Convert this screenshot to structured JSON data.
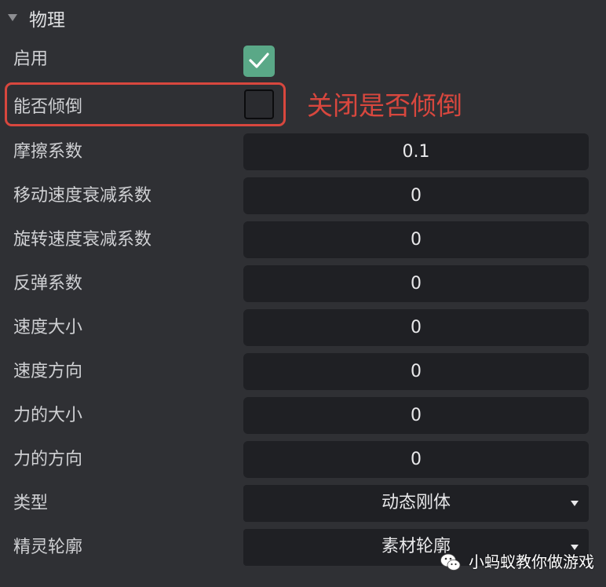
{
  "section": {
    "title": "物理",
    "collapse_icon": "triangle-down-icon"
  },
  "properties": {
    "enabled": {
      "label": "启用",
      "checked": true,
      "icon": "checkmark-icon",
      "color": "#5aa887"
    },
    "can_topple": {
      "label": "能否倾倒",
      "checked": false
    },
    "friction": {
      "label": "摩擦系数",
      "value": "0.1"
    },
    "linear_damping": {
      "label": "移动速度衰减系数",
      "value": "0"
    },
    "angular_damping": {
      "label": "旋转速度衰减系数",
      "value": "0"
    },
    "restitution": {
      "label": "反弹系数",
      "value": "0"
    },
    "speed_magnitude": {
      "label": "速度大小",
      "value": "0"
    },
    "speed_direction": {
      "label": "速度方向",
      "value": "0"
    },
    "force_magnitude": {
      "label": "力的大小",
      "value": "0"
    },
    "force_direction": {
      "label": "力的方向",
      "value": "0"
    },
    "body_type": {
      "label": "类型",
      "selected": "动态刚体"
    },
    "sprite_outline": {
      "label": "精灵轮廓",
      "selected": "素材轮廓"
    }
  },
  "annotation": {
    "text": "关闭是否倾倒",
    "color": "#d8473e"
  },
  "watermark": {
    "text": "小蚂蚁教你做游戏",
    "icon": "wechat-icon"
  }
}
